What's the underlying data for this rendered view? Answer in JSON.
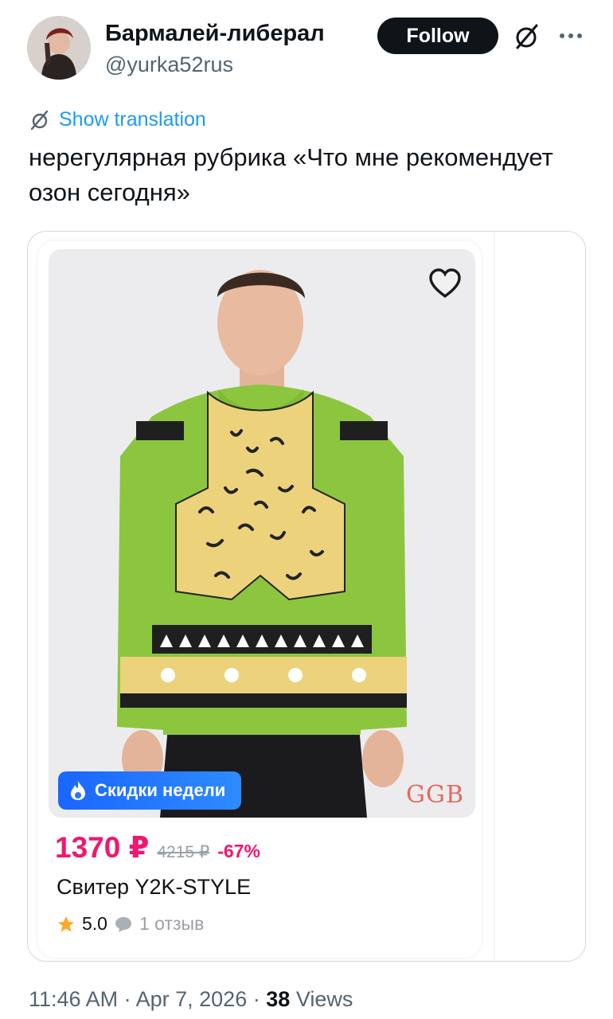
{
  "tweet": {
    "author_name": "Бармалей-либерал",
    "author_handle": "@yurka52rus",
    "follow_label": "Follow",
    "translate_label": "Show translation",
    "text": "нерегулярная рубрика «Что мне рекомендует озон сегодня»",
    "time": "11:46 AM",
    "separator": "·",
    "date": "Apr 7, 2026",
    "views_count": "38",
    "views_label": "Views"
  },
  "icons": {
    "avatar": "avatar",
    "grok": "grok-icon",
    "more": "more-icon",
    "translate": "translate-icon",
    "heart": "heart-icon",
    "fire": "fire-icon",
    "star": "star-icon",
    "comment": "comment-icon"
  },
  "product": {
    "badge": "Скидки недели",
    "brand": "GGB",
    "price": "1370 ₽",
    "old_price": "4215 ₽",
    "discount": "-67%",
    "title": "Свитер Y2K-STYLE",
    "rating": "5.0",
    "reviews": "1 отзыв"
  },
  "colors": {
    "follow_bg": "#0f1419",
    "link": "#1d9bf0",
    "price": "#f2166f",
    "badge": "#1a66ff",
    "sweater_green": "#8cc63f",
    "sweater_yellow": "#ecd27a"
  }
}
